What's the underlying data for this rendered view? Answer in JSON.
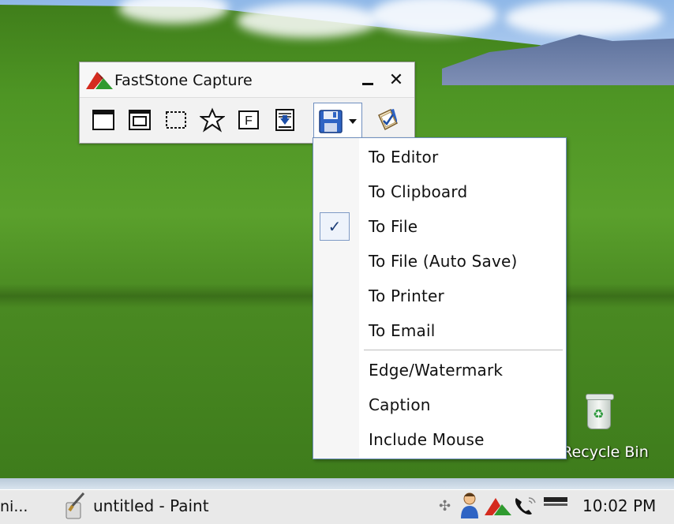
{
  "app": {
    "title": "FastStone Capture",
    "minimize_label": "minimize",
    "close_label": "✕"
  },
  "toolbar": {
    "buttons": [
      {
        "name": "capture-active-window-button",
        "icon": "window-icon"
      },
      {
        "name": "capture-window-object-button",
        "icon": "window-object-icon"
      },
      {
        "name": "capture-rectangular-region-button",
        "icon": "dashed-rect-icon"
      },
      {
        "name": "capture-freehand-region-button",
        "icon": "freehand-icon"
      },
      {
        "name": "capture-fixed-region-button",
        "icon": "fixed-region-icon"
      },
      {
        "name": "capture-scrolling-window-button",
        "icon": "scroll-icon"
      },
      {
        "name": "output-save-button",
        "icon": "floppy-disk-icon"
      },
      {
        "name": "settings-button",
        "icon": "settings-icon"
      }
    ],
    "fixed_label": "F"
  },
  "menu": {
    "items": [
      {
        "label": "To Editor",
        "checked": false
      },
      {
        "label": "To Clipboard",
        "checked": false
      },
      {
        "label": "To File",
        "checked": true
      },
      {
        "label": "To File (Auto Save)",
        "checked": false
      },
      {
        "label": "To Printer",
        "checked": false
      },
      {
        "label": "To Email",
        "checked": false
      },
      {
        "label": "Edge/Watermark",
        "checked": false
      },
      {
        "label": "Caption",
        "checked": false
      },
      {
        "label": "Include Mouse",
        "checked": false
      }
    ],
    "check_glyph": "✓"
  },
  "desktop": {
    "recycle_bin_label": "Recycle Bin"
  },
  "taskbar": {
    "left_task_label": "ni...",
    "paint_task_label": "untitled - Paint",
    "clock": "10:02 PM",
    "tray_move_glyph": "✣"
  },
  "colors": {
    "menu_border": "#6f8fbf",
    "check_bg": "#eef3fb",
    "accent_red": "#d42b1e",
    "accent_green": "#2f9a2f"
  }
}
